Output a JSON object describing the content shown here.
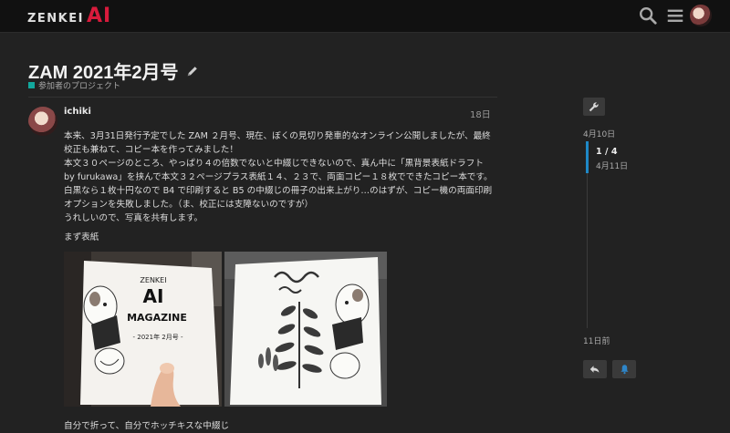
{
  "header": {
    "logo_text": "ZENKEI",
    "logo_ai": "AI",
    "icons": [
      "search-icon",
      "hamburger-menu-icon",
      "user-avatar"
    ],
    "accent_color": "#d81b3c"
  },
  "topic": {
    "title": "ZAM 2021年2月号",
    "category": "参加者のプロジェクト",
    "category_color": "#12a89d"
  },
  "post": {
    "username": "ichiki",
    "date": "18日",
    "body": "本来、3月31日発行予定でした ZAM ２月号、現在、ぼくの見切り発車的なオンライン公開しましたが、最終校正も兼ねて、コピー本を作ってみました！\n本文３０ページのところ、やっぱり４の倍数でないと中綴じできないので、真ん中に「黒背景表紙ドラフト by furukawa」を挟んで本文３２ページプラス表紙１４、２３で、両面コピー１８枚でできたコピー本です。白黒なら１枚十円なので B4 で印刷すると B5 の中綴じの冊子の出来上がり…のはずが、コピー機の両面印刷オプションを失敗しました。（ま、校正には支障ないのですが）\nうれしいので、写真を共有します。",
    "label_cover": "まず表紙",
    "caption": "自分で折って、自分でホッチキスな中綴じ",
    "photo1_text": {
      "brand": "ZENKEI",
      "ai": "AI",
      "magazine": "MAGAZINE",
      "issue": "- 2021年 2月号 -"
    }
  },
  "timeline": {
    "start_date": "4月10日",
    "position": "1 / 4",
    "current_date": "4月11日",
    "end_label": "11日前",
    "accent_color": "#1e88c7"
  }
}
